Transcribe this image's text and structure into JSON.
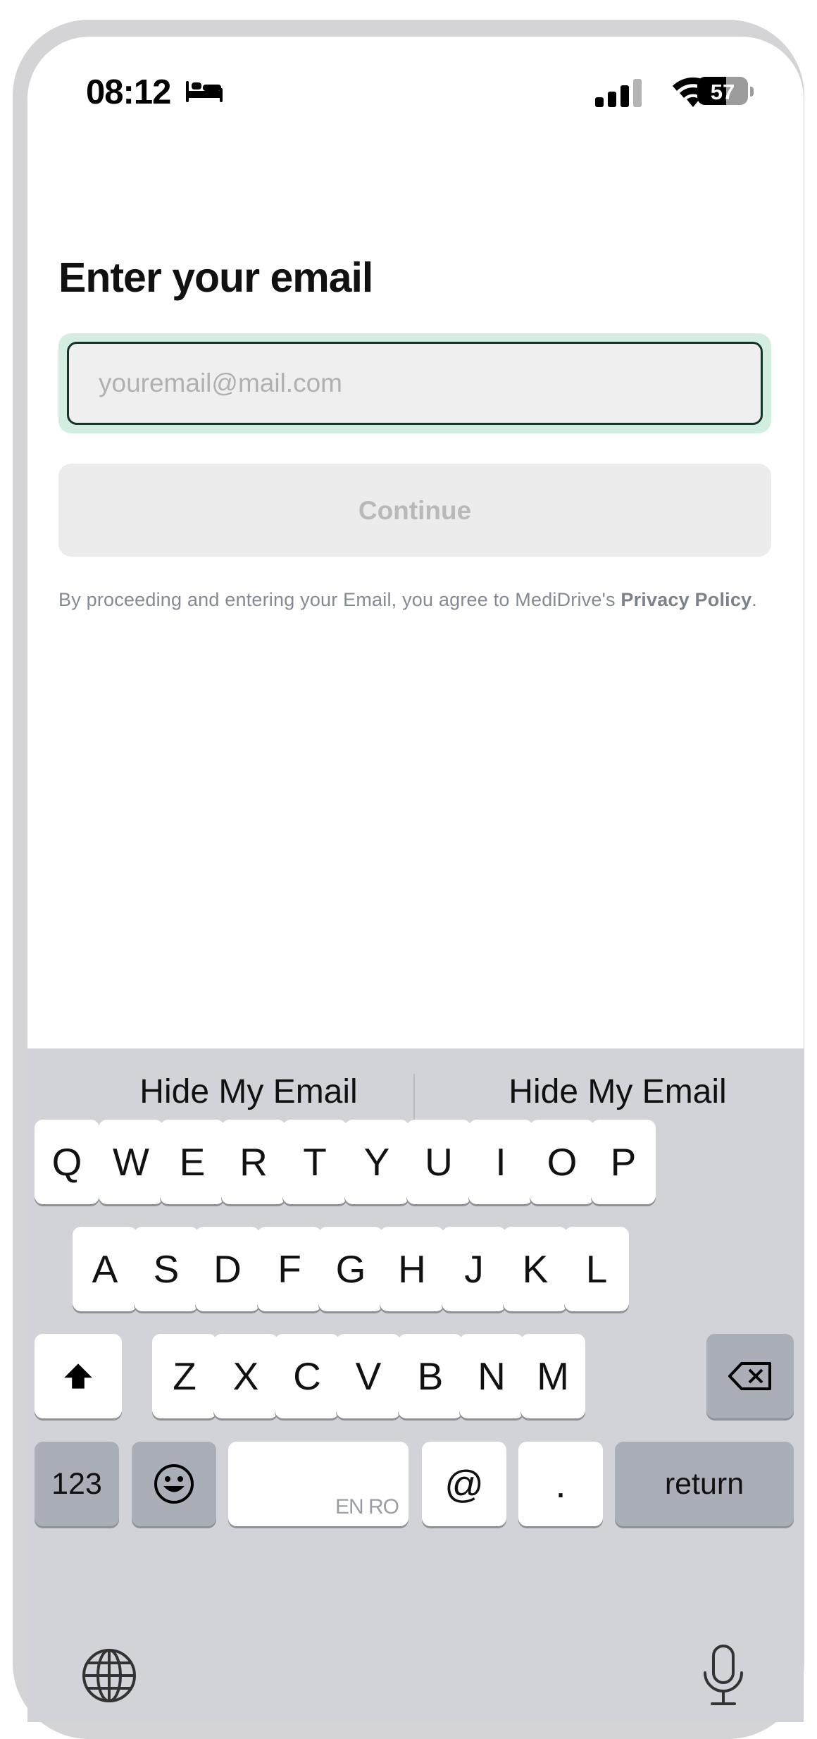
{
  "status_bar": {
    "time": "08:12",
    "mode_icon": "bed-icon",
    "battery_percent": "57",
    "battery_level": 0.57
  },
  "page": {
    "title": "Enter your email",
    "email_placeholder": "youremail@mail.com",
    "email_value": "",
    "continue_label": "Continue",
    "terms_text": "By proceeding and entering your Email, you agree to MediDrive's",
    "terms_link": "Privacy Policy",
    "terms_end": "."
  },
  "keyboard": {
    "suggestions": [
      "Hide My Email",
      "Hide My Email"
    ],
    "row1": [
      "Q",
      "W",
      "E",
      "R",
      "T",
      "Y",
      "U",
      "I",
      "O",
      "P"
    ],
    "row2": [
      "A",
      "S",
      "D",
      "F",
      "G",
      "H",
      "J",
      "K",
      "L"
    ],
    "row3": [
      "Z",
      "X",
      "C",
      "V",
      "B",
      "N",
      "M"
    ],
    "numbers_label": "123",
    "space_language": "EN RO",
    "at_label": "@",
    "dot_label": ".",
    "return_label": "return"
  },
  "colors": {
    "focus_ring": "#d4ede1",
    "field_border": "#17332a",
    "keyboard_bg": "#d1d3d9"
  }
}
